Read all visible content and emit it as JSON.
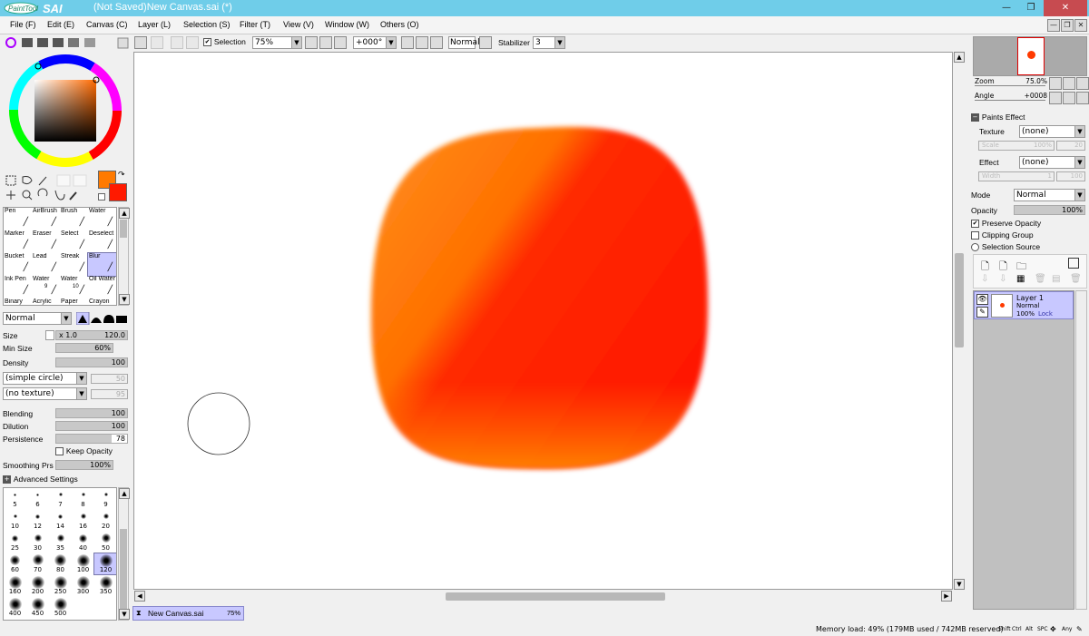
{
  "window": {
    "app_logo": "PaintTool SAI",
    "title": "(Not Saved)New Canvas.sai (*)"
  },
  "menu": [
    "File (F)",
    "Edit (E)",
    "Canvas (C)",
    "Layer (L)",
    "Selection (S)",
    "Filter (T)",
    "View (V)",
    "Window (W)",
    "Others (O)"
  ],
  "toolbar": {
    "selection_label": "Selection",
    "selection_checked": true,
    "zoom_value": "75%",
    "rotation_value": "+000°",
    "mode_label": "Normal",
    "stabilizer_label": "Stabilizer",
    "stabilizer_value": "3"
  },
  "colors": {
    "primary": "#ff7a00",
    "secondary": "#ff1a00",
    "accent": "#c8c8ff"
  },
  "brushes": [
    {
      "name": "Pen",
      "sub": ""
    },
    {
      "name": "AirBrush",
      "sub": ""
    },
    {
      "name": "Brush",
      "sub": ""
    },
    {
      "name": "Water",
      "sub": ""
    },
    {
      "name": "Marker",
      "sub": ""
    },
    {
      "name": "Eraser",
      "sub": ""
    },
    {
      "name": "Select",
      "sub": ""
    },
    {
      "name": "Deselect",
      "sub": ""
    },
    {
      "name": "Bucket",
      "sub": ""
    },
    {
      "name": "Lead",
      "sub": ""
    },
    {
      "name": "Streak",
      "sub": ""
    },
    {
      "name": "Blur",
      "sub": ""
    },
    {
      "name": "Ink Pen",
      "sub": ""
    },
    {
      "name": "Water",
      "sub": "9"
    },
    {
      "name": "Water",
      "sub": "10"
    },
    {
      "name": "Oil Water",
      "sub": ""
    },
    {
      "name": "Binary",
      "sub": ""
    },
    {
      "name": "Acrylic",
      "sub": ""
    },
    {
      "name": "Paper",
      "sub": ""
    },
    {
      "name": "Crayon",
      "sub": ""
    }
  ],
  "brush_settings": {
    "blend_mode": "Normal",
    "size_label": "Size",
    "size_mult": "x 1.0",
    "size_value": "120.0",
    "min_size_label": "Min Size",
    "min_size_value": "60%",
    "density_label": "Density",
    "density_value": "100",
    "shape": "(simple circle)",
    "shape_value": "50",
    "texture": "(no texture)",
    "texture_value": "95",
    "blending_label": "Blending",
    "blending_value": "100",
    "dilution_label": "Dilution",
    "dilution_value": "100",
    "persistence_label": "Persistence",
    "persistence_value": "78",
    "keep_opacity_label": "Keep Opacity",
    "smoothing_label": "Smoothing Prs",
    "smoothing_value": "100%",
    "advanced_label": "Advanced Settings"
  },
  "brush_sizes": [
    "5",
    "6",
    "7",
    "8",
    "9",
    "10",
    "12",
    "14",
    "16",
    "20",
    "25",
    "30",
    "35",
    "40",
    "50",
    "60",
    "70",
    "80",
    "100",
    "120",
    "160",
    "200",
    "250",
    "300",
    "350",
    "400",
    "450",
    "500"
  ],
  "navigator": {
    "zoom_label": "Zoom",
    "zoom_value": "75.0%",
    "angle_label": "Angle",
    "angle_value": "+0008"
  },
  "paint_effect": {
    "header": "Paints Effect",
    "texture_label": "Texture",
    "texture_value": "(none)",
    "scale_label": "Scale",
    "scale_value": "100%",
    "scale_num": "20",
    "effect_label": "Effect",
    "effect_value": "(none)",
    "width_label": "Width",
    "width_value": "1",
    "width_num": "100"
  },
  "layer_props": {
    "mode_label": "Mode",
    "mode_value": "Normal",
    "opacity_label": "Opacity",
    "opacity_value": "100%",
    "preserve_opacity": "Preserve Opacity",
    "clipping_group": "Clipping Group",
    "selection_source": "Selection Source"
  },
  "layers": [
    {
      "name": "Layer 1",
      "mode": "Normal",
      "opacity": "100%",
      "lock": "Lock"
    }
  ],
  "tabs": [
    {
      "name": "New Canvas.sai",
      "zoom": "75%"
    }
  ],
  "status": {
    "memory": "Memory load: 49% (179MB used / 742MB reserved)",
    "keys": [
      "Shift",
      "Ctrl",
      "Alt",
      "SPC",
      "Any"
    ]
  }
}
